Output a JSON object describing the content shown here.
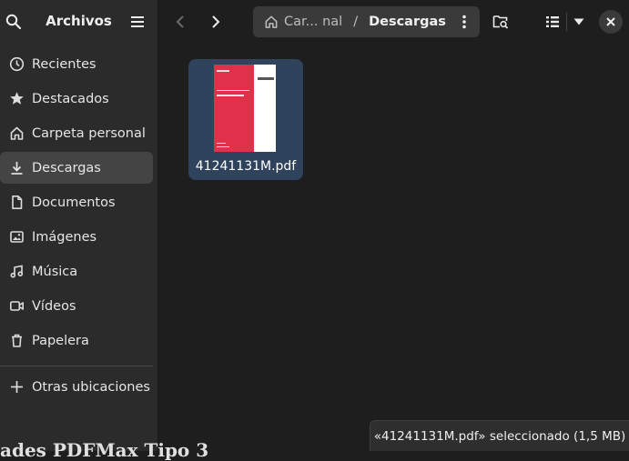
{
  "sidebar": {
    "title": "Archivos",
    "items": [
      {
        "label": "Recientes",
        "icon": "clock-icon"
      },
      {
        "label": "Destacados",
        "icon": "star-icon"
      },
      {
        "label": "Carpeta personal",
        "icon": "home-icon"
      },
      {
        "label": "Descargas",
        "icon": "download-icon",
        "active": true
      },
      {
        "label": "Documentos",
        "icon": "document-icon"
      },
      {
        "label": "Imágenes",
        "icon": "image-icon"
      },
      {
        "label": "Música",
        "icon": "music-icon"
      },
      {
        "label": "Vídeos",
        "icon": "video-icon"
      },
      {
        "label": "Papelera",
        "icon": "trash-icon"
      },
      {
        "label": "Otras ubicaciones",
        "icon": "plus-icon"
      }
    ]
  },
  "pathbar": {
    "crumb_home": "Car... nal",
    "separator": "/",
    "crumb_current": "Descargas"
  },
  "files": [
    {
      "name": "41241131M.pdf",
      "selected": true
    }
  ],
  "status": {
    "text": "«41241131M.pdf» seleccionado  (1,5 MB)"
  },
  "background_text": "ades PDFMax Tipo 3",
  "colors": {
    "accent_selection": "#2f435d",
    "sidebar_bg": "#2b2b2b",
    "content_bg": "#1e1e1e",
    "pdf_thumb_red": "#e0304a"
  }
}
